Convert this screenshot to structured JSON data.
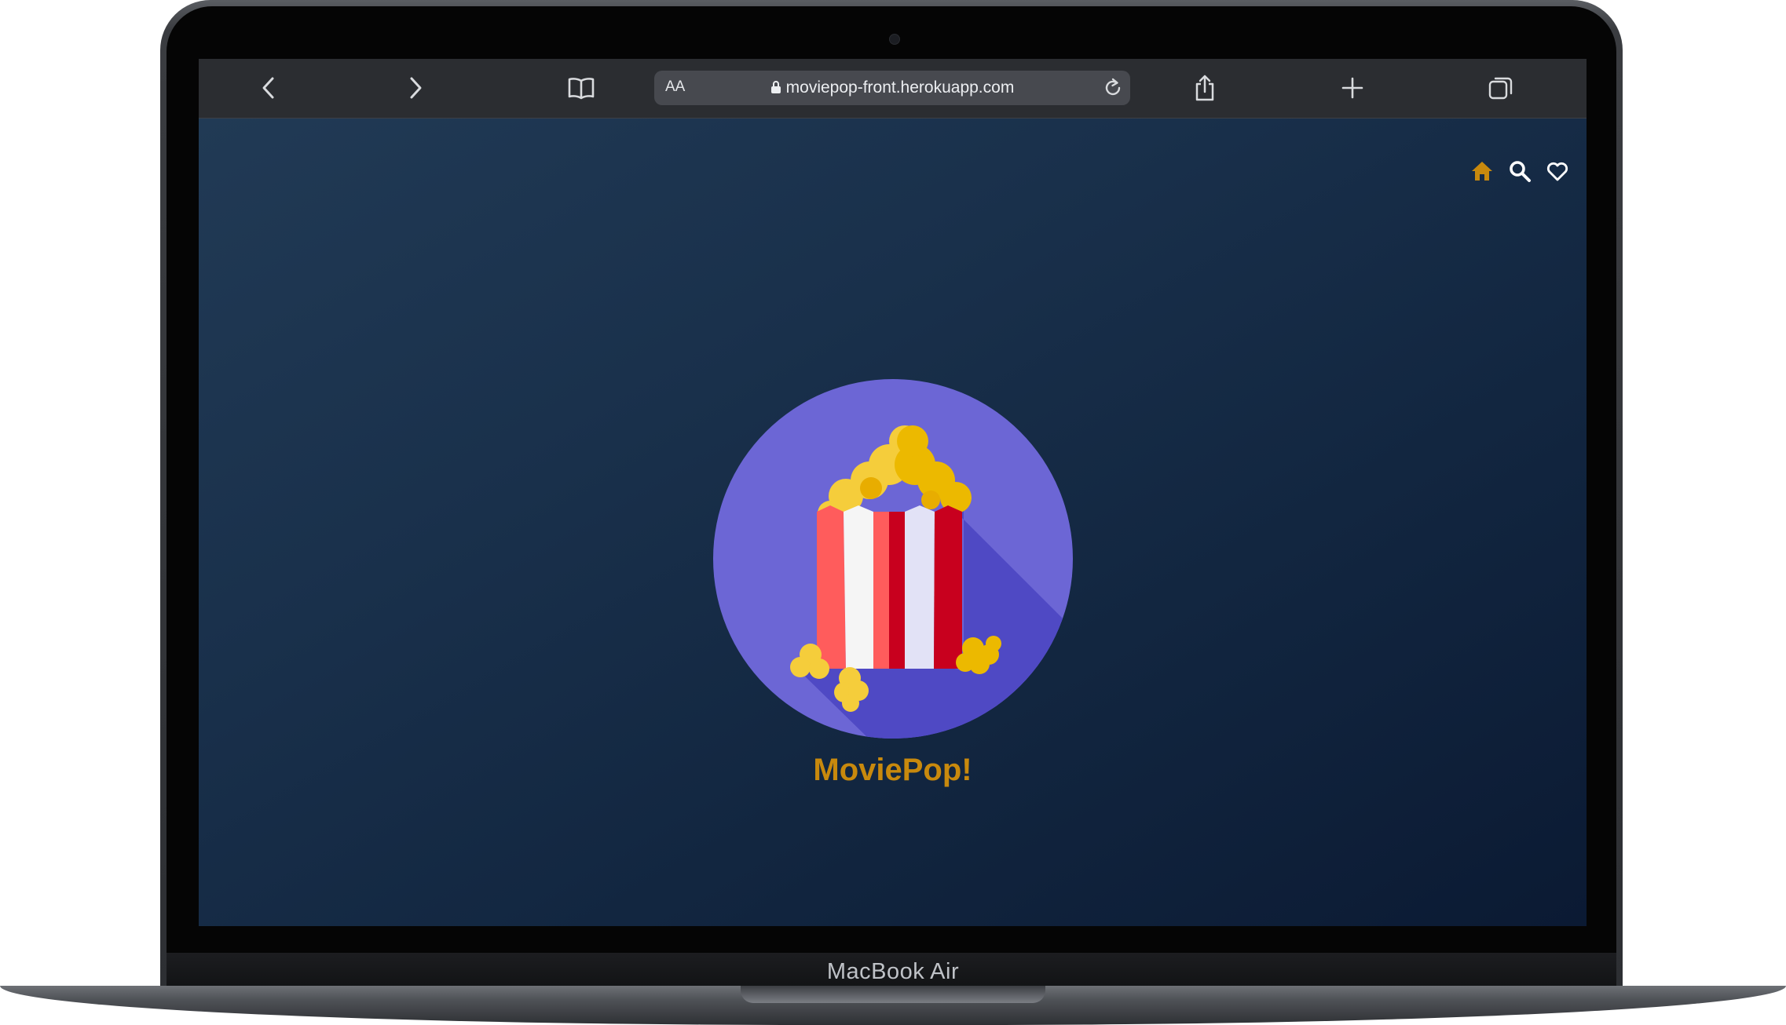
{
  "device": {
    "label": "MacBook Air"
  },
  "browser": {
    "text_size_label": "AA",
    "url": "moviepop-front.herokuapp.com",
    "icons": [
      "chevron-left-icon",
      "chevron-right-icon",
      "book-icon",
      "lock-icon",
      "reload-icon",
      "share-icon",
      "plus-icon",
      "tabs-icon"
    ]
  },
  "app": {
    "title": "MoviePop!",
    "accent_color": "#c8890d",
    "nav_icons": [
      "home-icon",
      "search-icon",
      "heart-icon"
    ]
  }
}
